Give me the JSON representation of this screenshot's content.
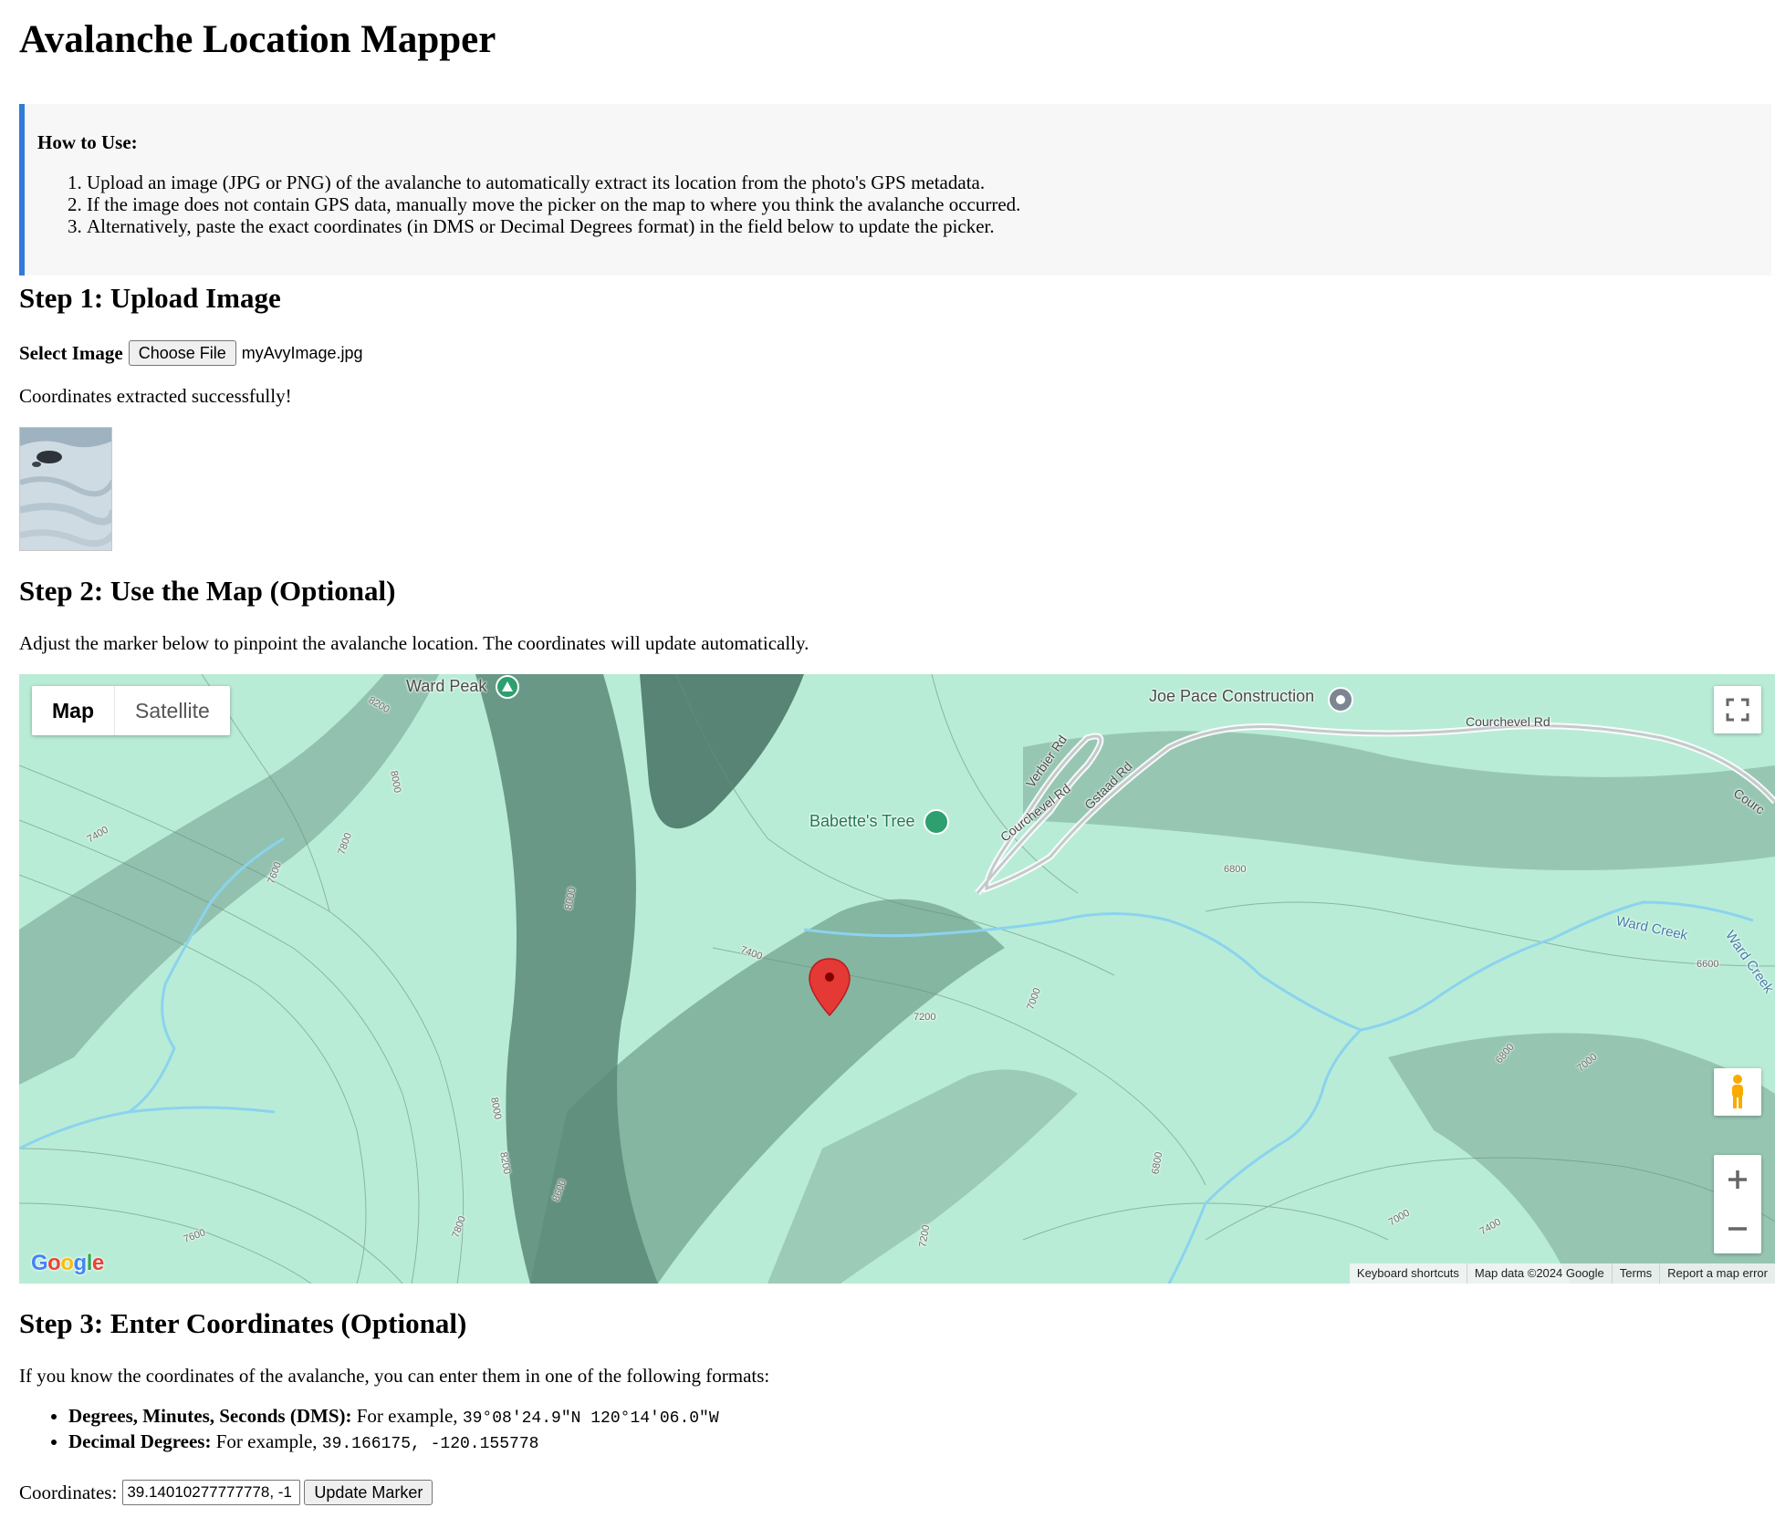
{
  "page_title": "Avalanche Location Mapper",
  "howto": {
    "title": "How to Use:",
    "steps": [
      "Upload an image (JPG or PNG) of the avalanche to automatically extract its location from the photo's GPS metadata.",
      "If the image does not contain GPS data, manually move the picker on the map to where you think the avalanche occurred.",
      "Alternatively, paste the exact coordinates (in DMS or Decimal Degrees format) in the field below to update the picker."
    ]
  },
  "step1": {
    "heading": "Step 1: Upload Image",
    "select_label": "Select Image",
    "choose_file_label": "Choose File",
    "file_name": "myAvyImage.jpg",
    "status": "Coordinates extracted successfully!"
  },
  "step2": {
    "heading": "Step 2: Use the Map (Optional)",
    "description": "Adjust the marker below to pinpoint the avalanche location. The coordinates will update automatically.",
    "map": {
      "map_type_active": "Map",
      "map_type_satellite": "Satellite",
      "labels": {
        "ward_peak": "Ward Peak",
        "joe_pace": "Joe Pace Construction",
        "courchevel_rd": "Courchevel Rd",
        "courchevel_rd_2": "Courchevel Rd",
        "courchevel_rd_edge": "Courc",
        "verbier_rd": "Verbier Rd",
        "gstaad_rd": "Gstaad Rd",
        "babettes_tree": "Babette's Tree",
        "ward_creek": "Ward Creek",
        "ward_creek_2": "Ward Creek"
      },
      "contours": [
        "7400",
        "7600",
        "8000",
        "7800",
        "8200",
        "8000",
        "7400",
        "7200",
        "7000",
        "6800",
        "6600",
        "6800",
        "7000",
        "7000",
        "7400",
        "6800",
        "7200",
        "8000",
        "7800",
        "8200",
        "8600",
        "7600"
      ],
      "attribution": {
        "shortcuts": "Keyboard shortcuts",
        "map_data": "Map data ©2024 Google",
        "terms": "Terms",
        "report": "Report a map error"
      },
      "logo": "Google",
      "accent_color": "#b9ecd6",
      "marker_color": "#e53935"
    }
  },
  "step3": {
    "heading": "Step 3: Enter Coordinates (Optional)",
    "description": "If you know the coordinates of the avalanche, you can enter them in one of the following formats:",
    "formats": [
      {
        "label": "Degrees, Minutes, Seconds (DMS):",
        "text": " For example, ",
        "example": "39°08'24.9\"N 120°14'06.0\"W"
      },
      {
        "label": "Decimal Degrees:",
        "text": " For example, ",
        "example": "39.166175, -120.155778"
      }
    ],
    "coord_label": "Coordinates:",
    "coord_value": "39.14010277777778, -1",
    "update_button": "Update Marker"
  }
}
